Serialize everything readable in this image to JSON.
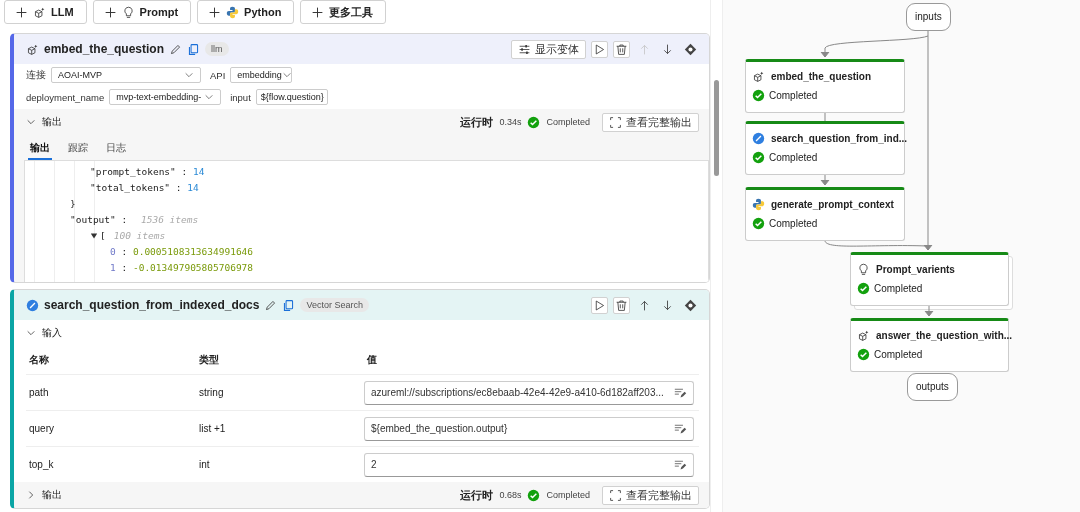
{
  "toolbar": [
    {
      "label": "LLM",
      "kind": "llm"
    },
    {
      "label": "Prompt",
      "kind": "prompt"
    },
    {
      "label": "Python",
      "kind": "python"
    },
    {
      "label": "更多工具",
      "kind": "none"
    }
  ],
  "nodes": [
    {
      "title": "embed_the_question",
      "kind": "llm",
      "tag": "llm",
      "variants_button": "显示变体",
      "move_up_disabled": true,
      "fields": [
        [
          {
            "label": "连接",
            "value": "AOAI-MVP",
            "kind": "select"
          },
          {
            "label": "API",
            "value": "embedding",
            "kind": "select"
          }
        ],
        [
          {
            "label": "deployment_name",
            "value": "mvp-text-embedding-",
            "kind": "select"
          },
          {
            "label": "input",
            "value": "${flow.question}",
            "kind": "text"
          }
        ]
      ],
      "output": {
        "title": "输出",
        "expanded": true,
        "run_label": "运行时",
        "run_time": "0.34s",
        "status": "Completed",
        "view_button": "查看完整输出",
        "tabs": [
          {
            "label": "输出",
            "selected": true
          },
          {
            "label": "跟踪",
            "selected": false
          },
          {
            "label": "日志",
            "selected": false
          }
        ],
        "code": [
          {
            "kind": "group",
            "children": [
              {
                "kind": "group",
                "children": [
                  {
                    "kind": "pair",
                    "key": "\"prompt_tokens\"",
                    "sep": ":",
                    "value": "14"
                  },
                  {
                    "kind": "pair",
                    "key": "\"total_tokens\"",
                    "sep": ":",
                    "value": "14"
                  }
                ]
              },
              {
                "kind": "brace",
                "text": "}"
              },
              {
                "kind": "pair",
                "key": "\"output\"",
                "sep": ":",
                "note": "1536 items",
                "children": [
                  {
                    "kind": "array",
                    "text": "[",
                    "note": "100 items",
                    "expanded": true,
                    "children": [
                      {
                        "kind": "index",
                        "key": "0",
                        "sep": ":",
                        "value": "0.0005108313634991646"
                      },
                      {
                        "kind": "index",
                        "key": "1",
                        "sep": ":",
                        "value": "-0.013497905805706978"
                      }
                    ]
                  }
                ]
              }
            ]
          }
        ]
      }
    },
    {
      "title": "search_question_from_indexed_docs",
      "kind": "vector",
      "tag": "Vector Search",
      "move_up_disabled": false,
      "inputs": {
        "title": "输入",
        "expanded": true,
        "columns": [
          "名称",
          "类型",
          "值"
        ],
        "rows": [
          {
            "name": "path",
            "type": "string",
            "value": "azureml://subscriptions/ec8ebaab-42e4-42e9-a410-6d182aff203..."
          },
          {
            "name": "query",
            "type": "list +1",
            "value": "${embed_the_question.output}"
          },
          {
            "name": "top_k",
            "type": "int",
            "value": "2"
          }
        ]
      },
      "output": {
        "title": "输出",
        "expanded": false,
        "run_label": "运行时",
        "run_time": "0.68s",
        "status": "Completed",
        "view_button": "查看完整输出"
      }
    }
  ],
  "graph": {
    "inputs": "inputs",
    "outputs": "outputs",
    "nodes": [
      {
        "title": "embed_the_question",
        "kind": "llm",
        "status": "Completed"
      },
      {
        "title": "search_question_from_ind...",
        "kind": "vector",
        "status": "Completed"
      },
      {
        "title": "generate_prompt_context",
        "kind": "python",
        "status": "Completed"
      },
      {
        "title": "Prompt_varients",
        "kind": "prompt",
        "status": "Completed",
        "stacked": true
      },
      {
        "title": "answer_the_question_with...",
        "kind": "llm",
        "status": "Completed"
      }
    ]
  }
}
